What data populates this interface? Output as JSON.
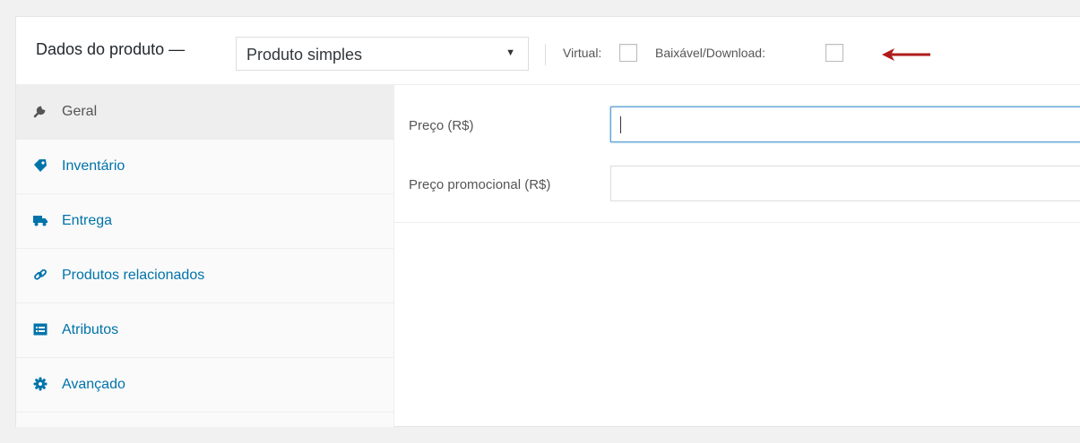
{
  "header": {
    "title": "Dados do produto —",
    "product_type": "Produto simples",
    "virtual_label": "Virtual:",
    "download_label": "Baixável/Download:",
    "virtual_checked": false,
    "download_checked": false
  },
  "tabs": [
    {
      "label": "Geral",
      "icon": "wrench-icon",
      "active": true
    },
    {
      "label": "Inventário",
      "icon": "tag-icon",
      "active": false
    },
    {
      "label": "Entrega",
      "icon": "truck-icon",
      "active": false
    },
    {
      "label": "Produtos relacionados",
      "icon": "link-icon",
      "active": false
    },
    {
      "label": "Atributos",
      "icon": "list-icon",
      "active": false
    },
    {
      "label": "Avançado",
      "icon": "gear-icon",
      "active": false
    }
  ],
  "fields": [
    {
      "label": "Preço (R$)",
      "value": ""
    },
    {
      "label": "Preço promocional (R$)",
      "value": ""
    }
  ],
  "colors": {
    "link": "#0073aa",
    "arrow": "#b01c1c",
    "focus": "#5b9dd9"
  }
}
